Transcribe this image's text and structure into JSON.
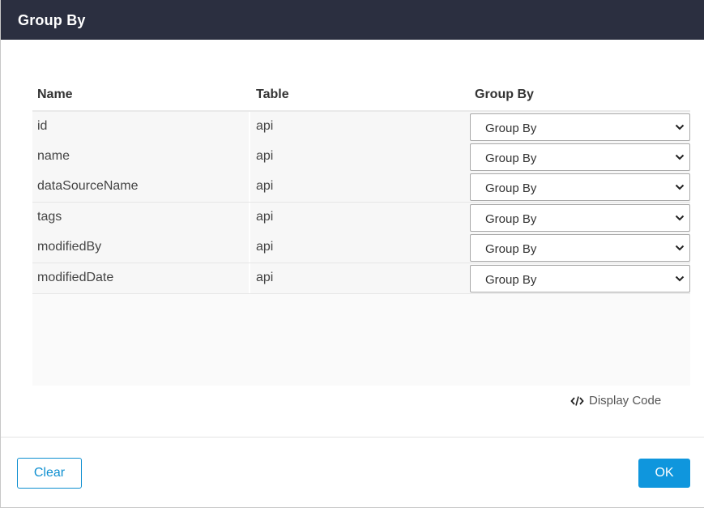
{
  "dialog": {
    "title": "Group By"
  },
  "table": {
    "headers": [
      "Name",
      "Table",
      "Group By"
    ],
    "rows": [
      {
        "name": "id",
        "table": "api",
        "group_by": "Group By"
      },
      {
        "name": "name",
        "table": "api",
        "group_by": "Group By"
      },
      {
        "name": "dataSourceName",
        "table": "api",
        "group_by": "Group By"
      },
      {
        "name": "tags",
        "table": "api",
        "group_by": "Group By"
      },
      {
        "name": "modifiedBy",
        "table": "api",
        "group_by": "Group By"
      },
      {
        "name": "modifiedDate",
        "table": "api",
        "group_by": "Group By"
      }
    ]
  },
  "links": {
    "display_code": "Display Code",
    "display_code_icon": "code-icon"
  },
  "buttons": {
    "clear": "Clear",
    "ok": "OK"
  },
  "colors": {
    "titlebar": "#2b2f40",
    "accent": "#0f96dd"
  }
}
